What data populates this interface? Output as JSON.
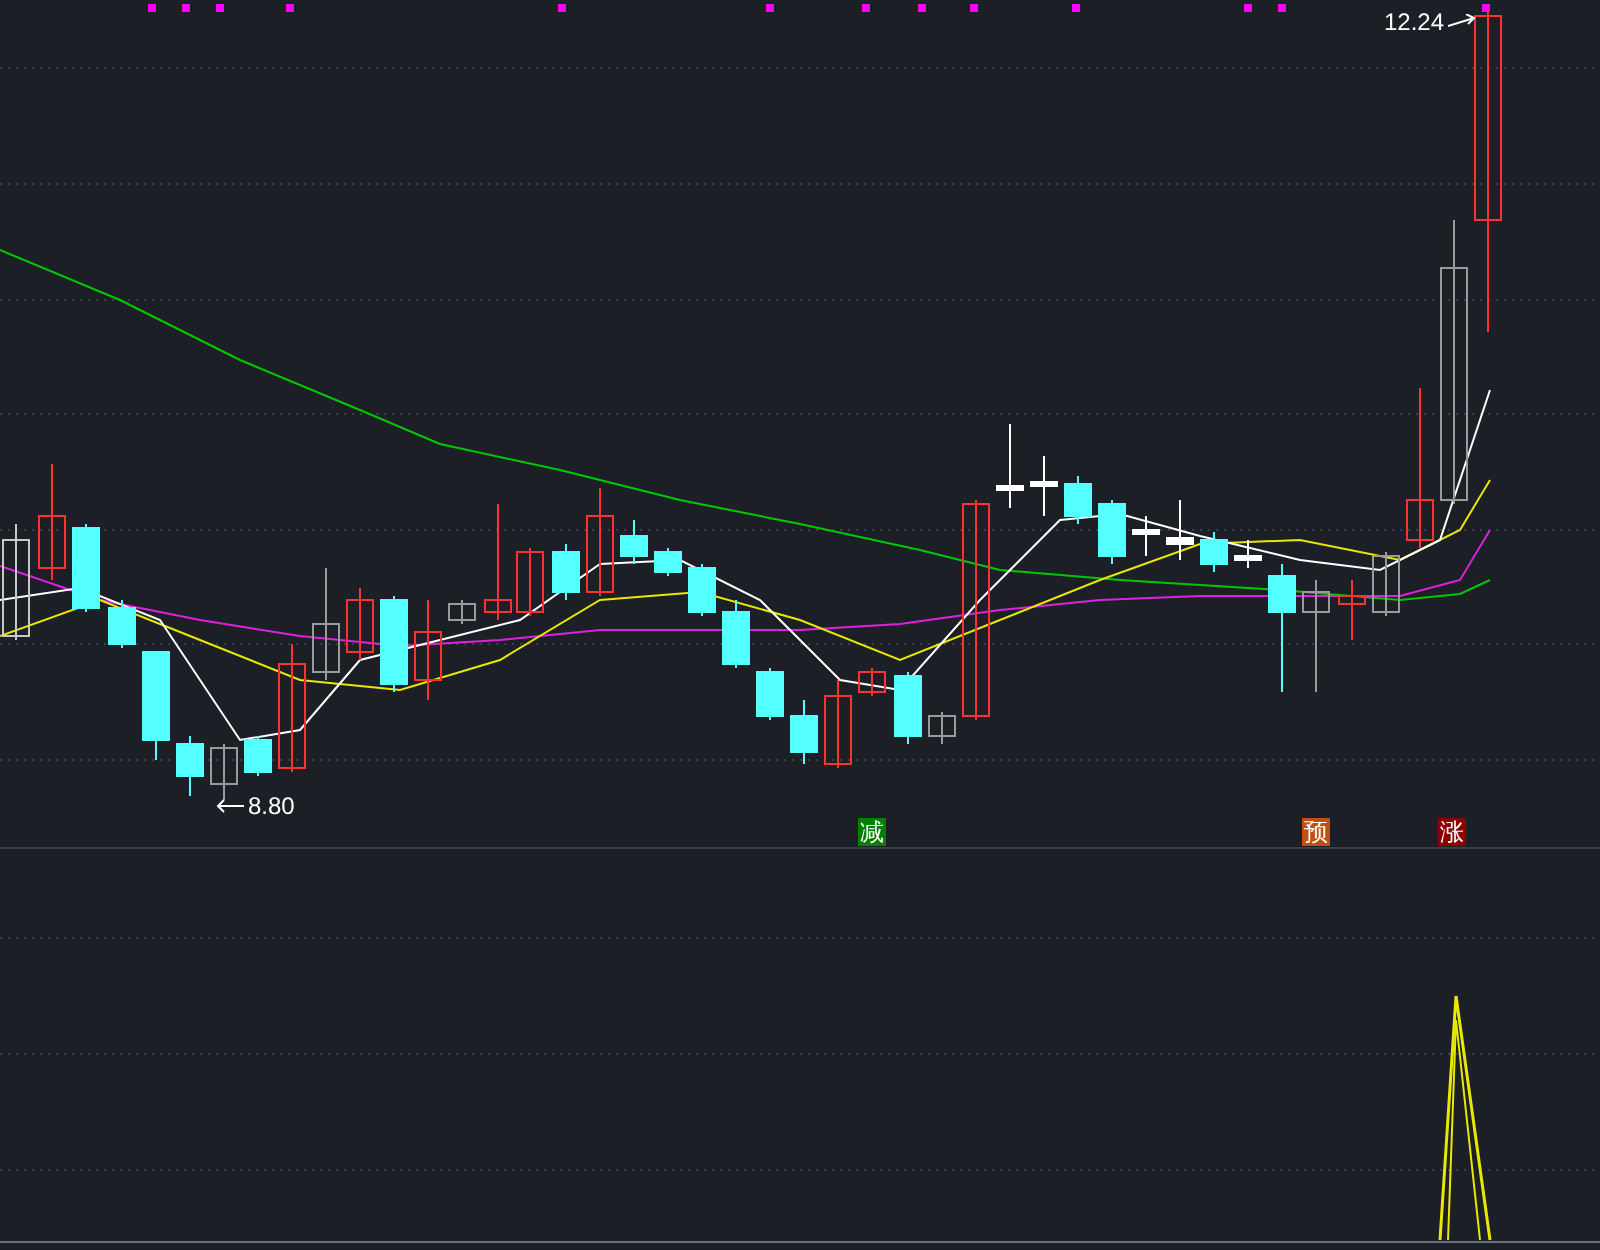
{
  "price_chart": {
    "high_label": "12.24",
    "low_label": "8.80"
  },
  "signals": [
    {
      "text": "减",
      "color": "#008000"
    },
    {
      "text": "预",
      "color": "#c05010"
    },
    {
      "text": "涨",
      "color": "#8b0000"
    }
  ]
}
